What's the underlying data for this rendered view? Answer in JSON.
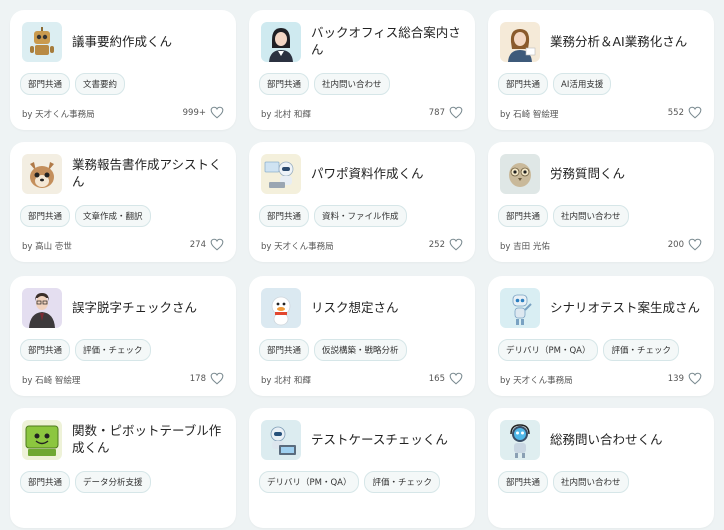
{
  "cards": [
    {
      "title": "議事要約作成くん",
      "tags": [
        "部門共通",
        "文書要約"
      ],
      "author": "by 天才くん事務局",
      "likes": "999+",
      "avatar": "robot-gold-avatar-icon",
      "bg": "#dceef2"
    },
    {
      "title": "バックオフィス総合案内さん",
      "tags": [
        "部門共通",
        "社内問い合わせ"
      ],
      "author": "by 北村 和輝",
      "likes": "787",
      "avatar": "office-woman-avatar-icon",
      "bg": "#cfeaf0"
    },
    {
      "title": "業務分析＆AI業務化さん",
      "tags": [
        "部門共通",
        "AI活用支援"
      ],
      "author": "by 石崎 智絵理",
      "likes": "552",
      "avatar": "analyst-woman-avatar-icon",
      "bg": "#f5ead8"
    },
    {
      "title": "業務報告書作成アシストくん",
      "tags": [
        "部門共通",
        "文章作成・翻訳"
      ],
      "author": "by 高山 壱世",
      "likes": "274",
      "avatar": "dog-avatar-icon",
      "bg": "#f3eee2"
    },
    {
      "title": "パワポ資料作成くん",
      "tags": [
        "部門共通",
        "資料・ファイル作成"
      ],
      "author": "by 天才くん事務局",
      "likes": "252",
      "avatar": "robot-laptop-avatar-icon",
      "bg": "#f4f0dc"
    },
    {
      "title": "労務質問くん",
      "tags": [
        "部門共通",
        "社内問い合わせ"
      ],
      "author": "by 吉田 光佑",
      "likes": "200",
      "avatar": "robot-owl-avatar-icon",
      "bg": "#dfe7e6"
    },
    {
      "title": "誤字脱字チェックさん",
      "tags": [
        "部門共通",
        "評価・チェック"
      ],
      "author": "by 石崎 智絵理",
      "likes": "178",
      "avatar": "businessman-avatar-icon",
      "bg": "#e4def0"
    },
    {
      "title": "リスク想定さん",
      "tags": [
        "部門共通",
        "仮説構築・戦略分析"
      ],
      "author": "by 北村 和輝",
      "likes": "165",
      "avatar": "duck-avatar-icon",
      "bg": "#dbe9f1"
    },
    {
      "title": "シナリオテスト案生成さん",
      "tags": [
        "デリバリ（PM・QA）",
        "評価・チェック"
      ],
      "author": "by 天才くん事務局",
      "likes": "139",
      "avatar": "robot-blue-avatar-icon",
      "bg": "#d9eef3"
    },
    {
      "title": "関数・ピボットテーブル作成くん",
      "tags": [
        "部門共通",
        "データ分析支援"
      ],
      "author": "",
      "likes": "",
      "avatar": "green-computer-avatar-icon",
      "bg": "#eef2d8"
    },
    {
      "title": "テストケースチェッくん",
      "tags": [
        "デリバリ（PM・QA）",
        "評価・チェック"
      ],
      "author": "",
      "likes": "",
      "avatar": "robot-laptop-blue-avatar-icon",
      "bg": "#dcecf0"
    },
    {
      "title": "総務問い合わせくん",
      "tags": [
        "部門共通",
        "社内問い合わせ"
      ],
      "author": "",
      "likes": "",
      "avatar": "robot-headset-avatar-icon",
      "bg": "#dfeef0"
    }
  ]
}
